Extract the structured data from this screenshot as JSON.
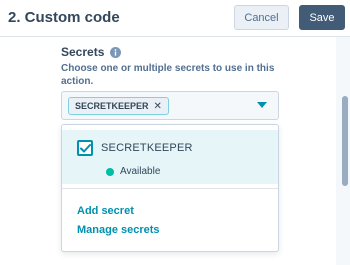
{
  "header": {
    "title": "2. Custom code",
    "cancel_label": "Cancel",
    "save_label": "Save"
  },
  "secrets": {
    "label": "Secrets",
    "help_text": "Choose one or multiple secrets to use in this action.",
    "selected_tag": "SECRETKEEPER",
    "remove_glyph": "✕"
  },
  "dropdown": {
    "options": [
      {
        "label": "SECRETKEEPER",
        "checked": true,
        "status": "Available"
      }
    ],
    "add_secret": "Add secret",
    "manage_secrets": "Manage secrets"
  },
  "colors": {
    "accent": "#0091ae",
    "save_button": "#425b76",
    "status_available": "#00bda5",
    "text": "#33475b"
  },
  "icons": [
    "info-icon",
    "close-icon",
    "caret-down-icon",
    "checkmark-icon",
    "status-dot-icon"
  ]
}
